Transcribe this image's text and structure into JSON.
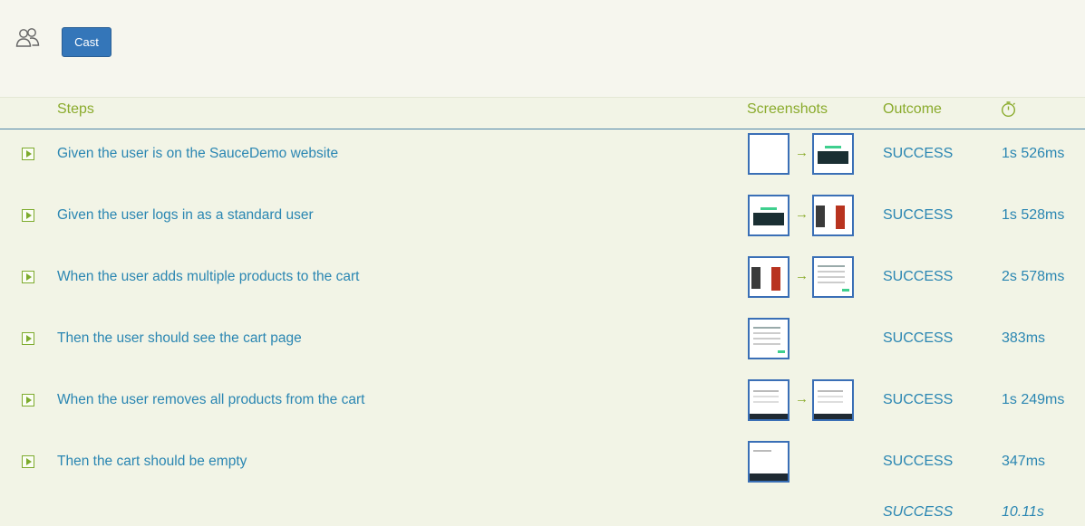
{
  "toolbar": {
    "cast_label": "Cast",
    "icon": "users-icon"
  },
  "table": {
    "headers": {
      "steps": "Steps",
      "screenshots": "Screenshots",
      "outcome": "Outcome",
      "duration_icon": "stopwatch-icon"
    },
    "rows": [
      {
        "step": "Given the user is on the SauceDemo website",
        "outcome": "SUCCESS",
        "duration": "1s 526ms",
        "screenshots": [
          "blank",
          "dark"
        ]
      },
      {
        "step": "Given the user logs in as a standard user",
        "outcome": "SUCCESS",
        "duration": "1s 528ms",
        "screenshots": [
          "dark",
          "products"
        ]
      },
      {
        "step": "When the user adds multiple products to the cart",
        "outcome": "SUCCESS",
        "duration": "2s 578ms",
        "screenshots": [
          "products",
          "cart"
        ]
      },
      {
        "step": "Then the user should see the cart page",
        "outcome": "SUCCESS",
        "duration": "383ms",
        "screenshots": [
          "cart"
        ]
      },
      {
        "step": "When the user removes all products from the cart",
        "outcome": "SUCCESS",
        "duration": "1s 249ms",
        "screenshots": [
          "darkfoot",
          "darkfoot"
        ]
      },
      {
        "step": "Then the cart should be empty",
        "outcome": "SUCCESS",
        "duration": "347ms",
        "screenshots": [
          "empty"
        ]
      }
    ],
    "total": {
      "outcome": "SUCCESS",
      "duration": "10.11s"
    }
  },
  "arrow_glyph": "→",
  "colors": {
    "accent": "#3476b9",
    "link": "#2a86b2",
    "header": "#8aab2c"
  }
}
